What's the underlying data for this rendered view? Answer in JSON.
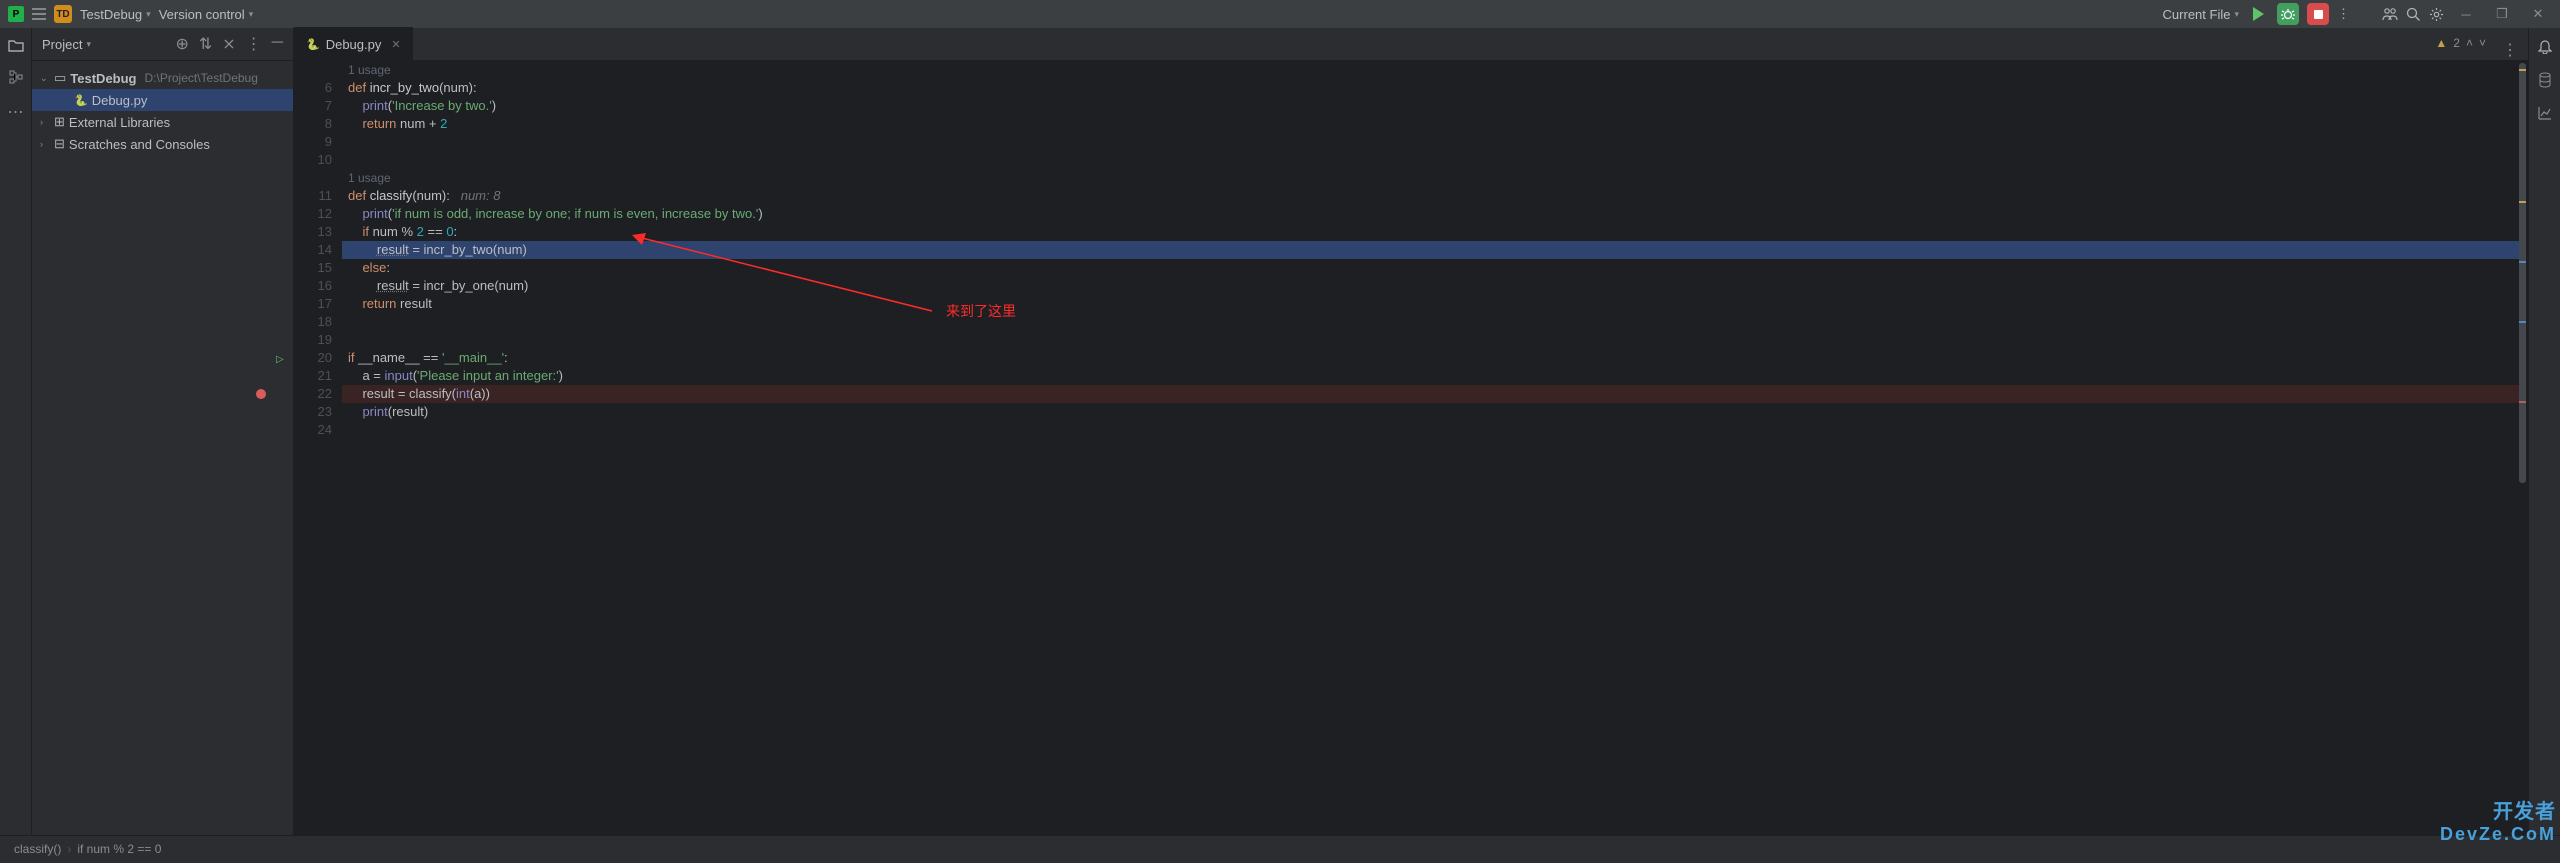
{
  "titlebar": {
    "project_badge": "TD",
    "project_name": "TestDebug",
    "menu_vcs": "Version control",
    "run_config": "Current File"
  },
  "project_panel": {
    "title": "Project",
    "root_name": "TestDebug",
    "root_path": "D:\\Project\\TestDebug",
    "file_name": "Debug.py",
    "ext_libs": "External Libraries",
    "scratches": "Scratches and Consoles"
  },
  "tab": {
    "name": "Debug.py"
  },
  "inspection": {
    "count": "2"
  },
  "lines": {
    "usage1": "1 usage",
    "usage2": "1 usage",
    "l6_def": "def ",
    "l6_name": "incr_by_two",
    "l6_rest": "(num):",
    "l7_print": "print",
    "l7_str": "'Increase by two.'",
    "l8_ret": "return ",
    "l8_var": "num + ",
    "l8_num": "2",
    "l11_def": "def ",
    "l11_name": "classify",
    "l11_rest": "(num):",
    "l11_hint": "   num: 8",
    "l12_print": "print",
    "l12_str": "'if num is odd, increase by one; if num is even, increase by two.'",
    "l13_if": "if ",
    "l13_cond": "num % ",
    "l13_n2": "2",
    "l13_eq": " == ",
    "l13_n0": "0",
    "l13_colon": ":",
    "l14_res": "result",
    "l14_eq": " = incr_by_two(num)",
    "l15_else": "else",
    "l15_colon": ":",
    "l16_res": "result",
    "l16_eq": " = incr_by_one(num)",
    "l17_ret": "return ",
    "l17_res": "result",
    "l20_if": "if ",
    "l20_name": "__name__ == ",
    "l20_main": "'__main__'",
    "l20_colon": ":",
    "l21_a": "a = ",
    "l21_input": "input",
    "l21_str": "'Please input an integer:'",
    "l22_res": "result = classify(",
    "l22_int": "int",
    "l22_rest": "(a))",
    "l23_print": "print",
    "l23_res": "(result)"
  },
  "line_numbers": [
    "6",
    "7",
    "8",
    "9",
    "10",
    "11",
    "12",
    "13",
    "14",
    "15",
    "16",
    "17",
    "18",
    "19",
    "20",
    "21",
    "22",
    "23",
    "24"
  ],
  "annotation": {
    "text": "来到了这里"
  },
  "statusbar": {
    "crumb1": "classify()",
    "crumb2": "if num % 2 == 0"
  },
  "watermark": {
    "line1": "开发者",
    "line2": "DevZe.CoM"
  }
}
